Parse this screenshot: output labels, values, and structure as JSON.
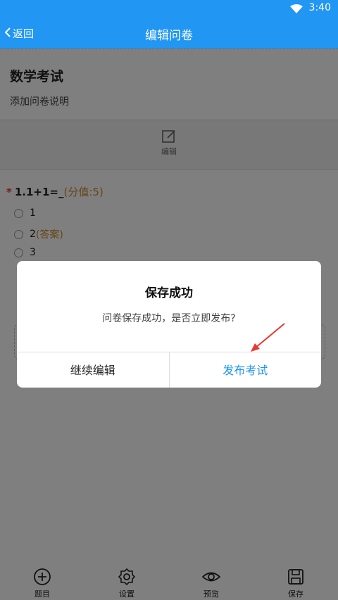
{
  "status_bar": {
    "time": "3:40",
    "wifi_icon": "wifi-icon"
  },
  "header": {
    "back_label": "返回",
    "title": "编辑问卷"
  },
  "survey": {
    "title": "数学考试",
    "description": "添加问卷说明",
    "edit_label": "编辑"
  },
  "question": {
    "required_mark": "*",
    "text": "1.1+1=_",
    "score": "(分值:5)",
    "options": [
      {
        "label": "1",
        "answer_tag": ""
      },
      {
        "label": "2",
        "answer_tag": "(答案)"
      },
      {
        "label": "3",
        "answer_tag": ""
      }
    ]
  },
  "bottom_nav": [
    {
      "label": "题目",
      "icon": "plus-circle-icon"
    },
    {
      "label": "设置",
      "icon": "gear-icon"
    },
    {
      "label": "预览",
      "icon": "eye-icon"
    },
    {
      "label": "保存",
      "icon": "save-icon"
    }
  ],
  "dialog": {
    "title": "保存成功",
    "message": "问卷保存成功，是否立即发布?",
    "cancel_label": "继续编辑",
    "confirm_label": "发布考试"
  },
  "colors": {
    "primary": "#2196f3",
    "accent": "#c98a2e",
    "required": "#e53935",
    "annotation": "#e53935"
  }
}
